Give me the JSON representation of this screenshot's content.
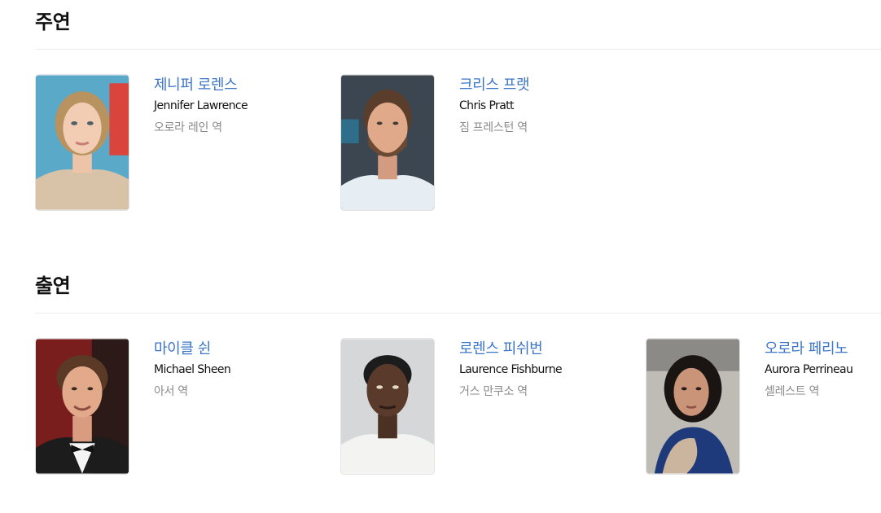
{
  "sections": [
    {
      "title": "주연",
      "cast": [
        {
          "name_ko": "제니퍼 로렌스",
          "name_en": "Jennifer Lawrence",
          "role": "오로라 레인 역"
        },
        {
          "name_ko": "크리스 프랫",
          "name_en": "Chris Pratt",
          "role": "짐 프레스턴 역"
        }
      ]
    },
    {
      "title": "출연",
      "cast": [
        {
          "name_ko": "마이클 쉰",
          "name_en": "Michael Sheen",
          "role": "아서 역"
        },
        {
          "name_ko": "로렌스 피쉬번",
          "name_en": "Laurence Fishburne",
          "role": "거스 만쿠소 역"
        },
        {
          "name_ko": "오로라 페리노",
          "name_en": "Aurora Perrineau",
          "role": "셀레스트 역"
        }
      ]
    }
  ]
}
